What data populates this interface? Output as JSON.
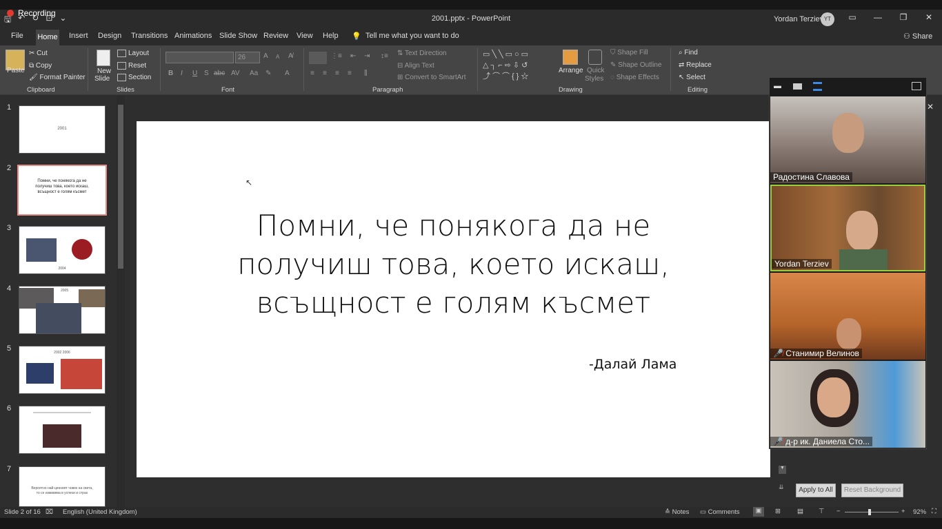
{
  "app": {
    "title": "2001.pptx  -  PowerPoint",
    "user_name": "Yordan Terziev",
    "user_initials": "YT",
    "recording_label": "Recording"
  },
  "menu": {
    "tabs": [
      "File",
      "Home",
      "Insert",
      "Design",
      "Transitions",
      "Animations",
      "Slide Show",
      "Review",
      "View",
      "Help"
    ],
    "tell_me": "Tell me what you want to do",
    "share": "Share"
  },
  "ribbon": {
    "clipboard": {
      "paste": "Paste",
      "cut": "Cut",
      "copy": "Copy",
      "format_painter": "Format Painter",
      "label": "Clipboard"
    },
    "slides": {
      "new_slide_1": "New",
      "new_slide_2": "Slide",
      "layout": "Layout",
      "reset": "Reset",
      "section": "Section",
      "label": "Slides"
    },
    "font": {
      "font_name": "",
      "font_size": "26",
      "bold": "B",
      "italic": "I",
      "underline": "U",
      "shadow": "S",
      "strike": "abc",
      "spacing": "AV",
      "case": "Aa",
      "color": "A",
      "grow": "A",
      "shrink": "A",
      "label": "Font"
    },
    "paragraph": {
      "text_direction": "Text Direction",
      "align_text": "Align Text",
      "smartart": "Convert to SmartArt",
      "label": "Paragraph"
    },
    "drawing": {
      "arrange": "Arrange",
      "quick_styles_1": "Quick",
      "quick_styles_2": "Styles",
      "shape_fill": "Shape Fill",
      "shape_outline": "Shape Outline",
      "shape_effects": "Shape Effects",
      "label": "Drawing"
    },
    "editing": {
      "find": "Find",
      "replace": "Replace",
      "select": "Select",
      "label": "Editing"
    }
  },
  "thumbnails": [
    {
      "num": "1",
      "text": "2001"
    },
    {
      "num": "2",
      "text": "Помни, че понякога да не получиш това, което искаш, всъщност е голям късмет"
    },
    {
      "num": "3",
      "text": "2004"
    },
    {
      "num": "4",
      "text": "2005"
    },
    {
      "num": "5",
      "text": "2002 2006"
    },
    {
      "num": "6",
      "text": ""
    },
    {
      "num": "7",
      "text": "Вероятно най-ценният човек на света, то се изживява в успехи и страх"
    }
  ],
  "slide": {
    "quote_line1": "Помни, че понякога да не",
    "quote_line2": "получиш това, което искаш,",
    "quote_line3": "всъщност е голям късмет",
    "author": "-Далай Лама"
  },
  "participants": [
    {
      "name": "Радостина Славова",
      "muted": false,
      "bg": "#8a7a72"
    },
    {
      "name": "Yordan Terziev",
      "muted": false,
      "bg": "#6b4a2e"
    },
    {
      "name": "Станимир Велинов",
      "muted": true,
      "bg": "#b5642a"
    },
    {
      "name": "д-р ик. Даниела Сто...",
      "muted": true,
      "bg": "#b8b2aa"
    }
  ],
  "format_pane": {
    "apply_all": "Apply to All",
    "reset_bg": "Reset Background"
  },
  "status": {
    "slide_count": "Slide 2 of 16",
    "language": "English (United Kingdom)",
    "notes": "Notes",
    "comments": "Comments",
    "zoom": "92%"
  }
}
